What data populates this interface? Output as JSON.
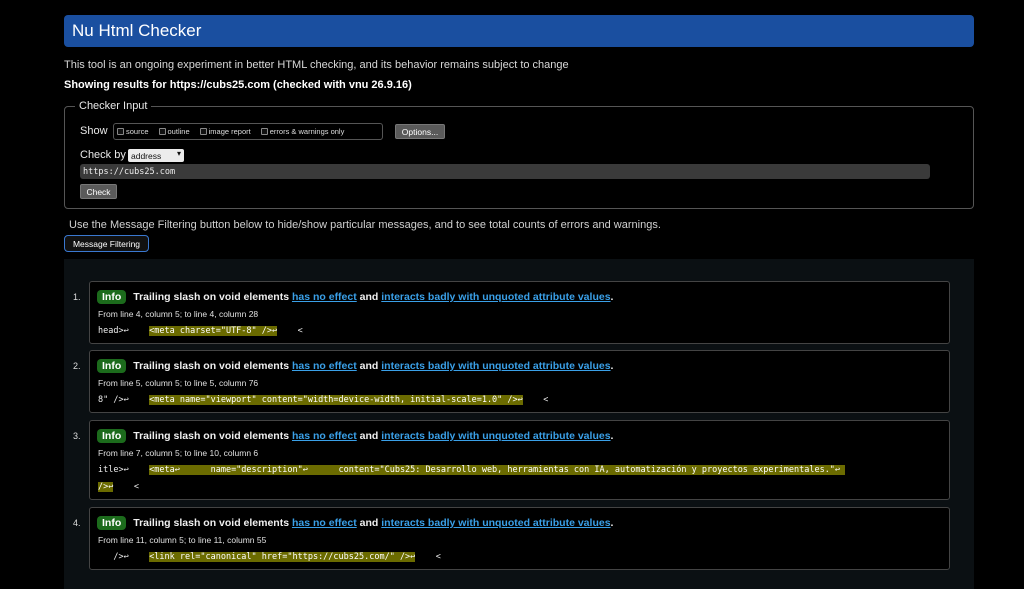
{
  "header": {
    "title": "Nu Html Checker"
  },
  "intro_text": "This tool is an ongoing experiment in better HTML checking, and its behavior remains subject to change",
  "showing_text": "Showing results for https://cubs25.com (checked with vnu 26.9.16)",
  "checker_input": {
    "legend": "Checker Input",
    "show_label": "Show",
    "options": [
      "source",
      "outline",
      "image report",
      "errors & warnings only"
    ],
    "options_button": "Options...",
    "check_by_label": "Check by",
    "check_by_value": "address",
    "url_value": "https://cubs25.com",
    "check_button": "Check"
  },
  "filter_text": "Use the Message Filtering button below to hide/show particular messages, and to see total counts of errors and warnings.",
  "filter_button": "Message Filtering",
  "messages": [
    {
      "num": "1.",
      "badge": "Info",
      "title": "Trailing slash on void elements",
      "link1": "has no effect",
      "and_text": "and",
      "link2": "interacts badly with unquoted attribute values",
      "period": ".",
      "location": "From line 4, column 5; to line 4, column 28",
      "code_before": "head>↩    ",
      "code_hl": "<meta charset=\"UTF-8\" />↩",
      "code_after": "    <",
      "code_line2_hl": "",
      "code_line2_after": ""
    },
    {
      "num": "2.",
      "badge": "Info",
      "title": "Trailing slash on void elements",
      "link1": "has no effect",
      "and_text": "and",
      "link2": "interacts badly with unquoted attribute values",
      "period": ".",
      "location": "From line 5, column 5; to line 5, column 76",
      "code_before": "8\" />↩    ",
      "code_hl": "<meta name=\"viewport\" content=\"width=device-width, initial-scale=1.0\" />↩",
      "code_after": "    <",
      "code_line2_hl": "",
      "code_line2_after": ""
    },
    {
      "num": "3.",
      "badge": "Info",
      "title": "Trailing slash on void elements",
      "link1": "has no effect",
      "and_text": "and",
      "link2": "interacts badly with unquoted attribute values",
      "period": ".",
      "location": "From line 7, column 5; to line 10, column 6",
      "code_before": "itle>↩    ",
      "code_hl": "<meta↩      name=\"description\"↩      content=\"Cubs25: Desarrollo web, herramientas con IA, automatización y proyectos experimentales.\"↩ ",
      "code_after": "",
      "code_line2_hl": "/>↩",
      "code_line2_after": "    <"
    },
    {
      "num": "4.",
      "badge": "Info",
      "title": "Trailing slash on void elements",
      "link1": "has no effect",
      "and_text": "and",
      "link2": "interacts badly with unquoted attribute values",
      "period": ".",
      "location": "From line 11, column 5; to line 11, column 55",
      "code_before": "   />↩    ",
      "code_hl": "<link rel=\"canonical\" href=\"https://cubs25.com/\" />↩",
      "code_after": "    <",
      "code_line2_hl": "",
      "code_line2_after": ""
    }
  ]
}
